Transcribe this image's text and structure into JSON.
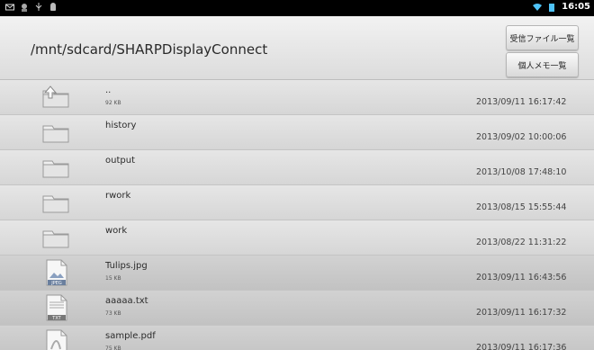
{
  "status_bar": {
    "time": "16:05"
  },
  "header": {
    "path": "/mnt/sdcard/SHARPDisplayConnect",
    "buttons": [
      "受信ファイル一覧",
      "個人メモ一覧"
    ]
  },
  "files": [
    {
      "name": "..",
      "size": "92 KB",
      "date": "2013/09/11 16:17:42",
      "icon": "folder-up-icon",
      "kind": "dir"
    },
    {
      "name": "history",
      "size": "",
      "date": "2013/09/02 10:00:06",
      "icon": "folder-icon",
      "kind": "dir"
    },
    {
      "name": "output",
      "size": "",
      "date": "2013/10/08 17:48:10",
      "icon": "folder-icon",
      "kind": "dir"
    },
    {
      "name": "rwork",
      "size": "",
      "date": "2013/08/15 15:55:44",
      "icon": "folder-icon",
      "kind": "dir"
    },
    {
      "name": "work",
      "size": "",
      "date": "2013/08/22 11:31:22",
      "icon": "folder-icon",
      "kind": "dir"
    },
    {
      "name": "Tulips.jpg",
      "size": "15 KB",
      "date": "2013/09/11 16:43:56",
      "icon": "jpeg-file-icon",
      "kind": "file",
      "badge": "JPEG"
    },
    {
      "name": "aaaaa.txt",
      "size": "73 KB",
      "date": "2013/09/11 16:17:32",
      "icon": "text-file-icon",
      "kind": "file",
      "badge": "TXT"
    },
    {
      "name": "sample.pdf",
      "size": "75 KB",
      "date": "2013/09/11 16:17:36",
      "icon": "pdf-file-icon",
      "kind": "file",
      "badge": ""
    }
  ]
}
